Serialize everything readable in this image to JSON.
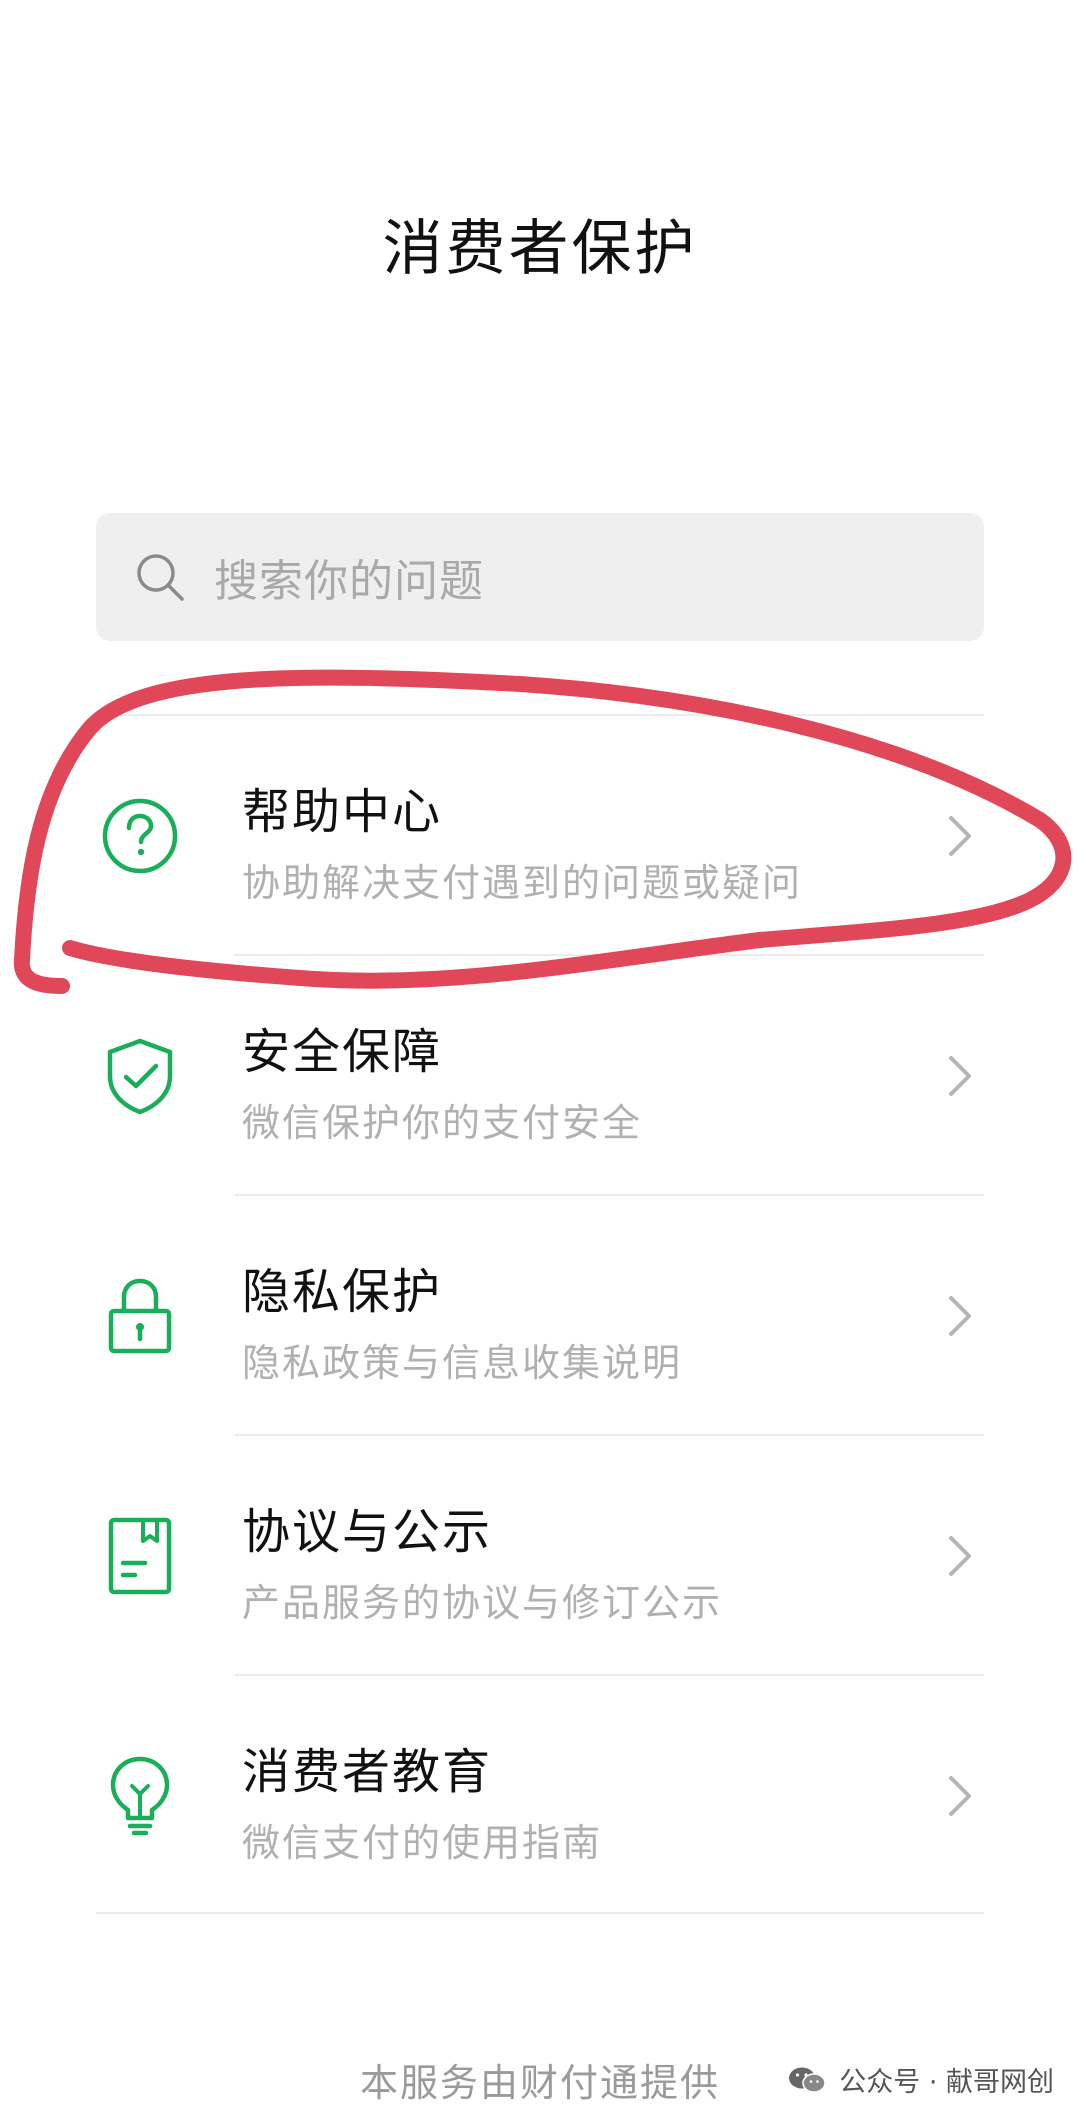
{
  "header": {
    "title": "消费者保护"
  },
  "search": {
    "placeholder": "搜索你的问题"
  },
  "menu": {
    "items": [
      {
        "title": "帮助中心",
        "description": "协助解决支付遇到的问题或疑问",
        "icon": "help-circle-icon"
      },
      {
        "title": "安全保障",
        "description": "微信保护你的支付安全",
        "icon": "shield-check-icon"
      },
      {
        "title": "隐私保护",
        "description": "隐私政策与信息收集说明",
        "icon": "lock-icon"
      },
      {
        "title": "协议与公示",
        "description": "产品服务的协议与修订公示",
        "icon": "document-icon"
      },
      {
        "title": "消费者教育",
        "description": "微信支付的使用指南",
        "icon": "lightbulb-icon"
      }
    ]
  },
  "footer": {
    "text": "本服务由财付通提供"
  },
  "watermark": {
    "text": "公众号 · 献哥网创"
  },
  "colors": {
    "accent_green": "#1aad5a",
    "annotation_red": "#e0485a"
  }
}
